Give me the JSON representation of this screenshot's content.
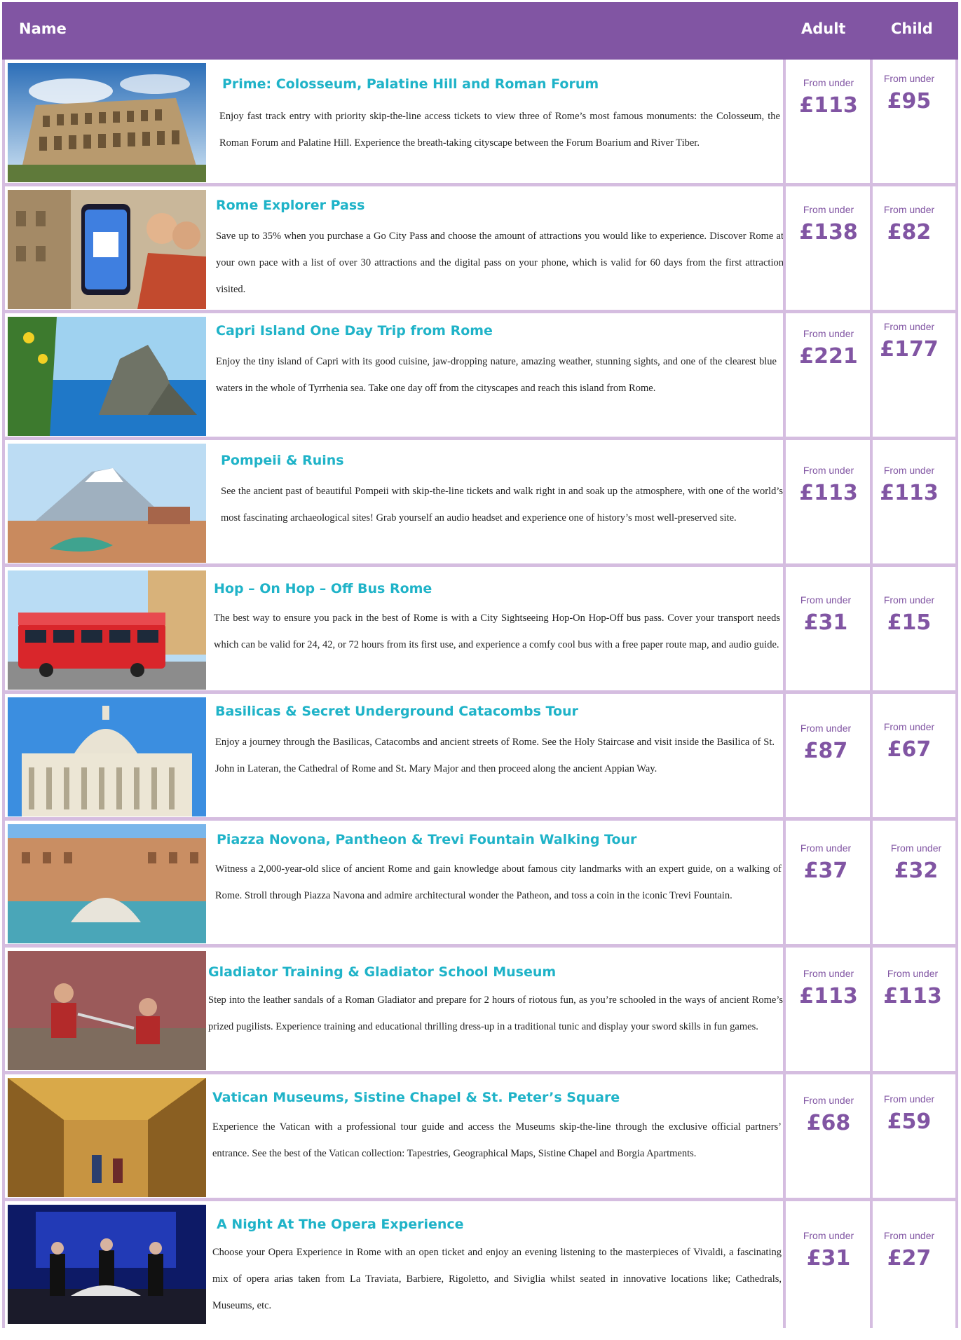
{
  "header": {
    "name": "Name",
    "adult": "Adult",
    "child": "Child"
  },
  "rows": [
    {
      "title": "Prime: Colosseum, Palatine Hill and Roman Forum",
      "desc": "Enjoy fast track entry with priority skip-the-line access tickets to view three of Rome’s most famous monuments: the Colosseum, the Roman Forum and Palatine Hill. Experience the breath-taking cityscape between the Forum Boarium and River Tiber.",
      "adult_from": "From under",
      "adult_price": "£113",
      "child_from": "From under",
      "child_price": "£95"
    },
    {
      "title": "Rome Explorer Pass",
      "desc": "Save up to 35% when you purchase a Go City Pass and choose the amount of attractions you would like to experience. Discover Rome at your own pace with a list of over 30 attractions and the digital pass on your phone, which is valid for 60 days from the first attraction visited.",
      "adult_from": "From under",
      "adult_price": "£138",
      "child_from": "From under",
      "child_price": "£82"
    },
    {
      "title": "Capri Island One Day Trip from Rome",
      "desc": "Enjoy the tiny island of Capri with its good cuisine, jaw-dropping nature, amazing weather, stunning sights, and one of the clearest blue waters in the whole of Tyrrhenia sea. Take one day off from the cityscapes and reach this island from Rome.",
      "adult_from": "From under",
      "adult_price": "£221",
      "child_from": "From under",
      "child_price": "£177"
    },
    {
      "title": "Pompeii & Ruins",
      "desc": "See the ancient past of beautiful Pompeii with skip-the-line tickets and walk right in and soak up the atmosphere, with one of the world’s most fascinating archaeological sites! Grab yourself an audio headset and experience one of history’s most well-preserved site.",
      "adult_from": "From under",
      "adult_price": "£113",
      "child_from": "From under",
      "child_price": "£113"
    },
    {
      "title": "Hop – On Hop – Off Bus Rome",
      "desc": "The best way to ensure you pack in the best of Rome is with a City Sightseeing Hop-On Hop-Off bus pass. Cover your transport needs which can be valid for 24, 42, or 72 hours from its first use, and experience a comfy cool bus with a free paper route map, and audio guide.",
      "adult_from": "From under",
      "adult_price": "£31",
      "child_from": "From under",
      "child_price": "£15"
    },
    {
      "title": "Basilicas & Secret Underground Catacombs Tour",
      "desc": "Enjoy a journey through the Basilicas, Catacombs and ancient streets of Rome. See the Holy Staircase and visit inside the Basilica of St. John in Lateran, the Cathedral of Rome and St. Mary Major and then proceed along the ancient Appian Way.",
      "adult_from": "From under",
      "adult_price": "£87",
      "child_from": "From under",
      "child_price": "£67"
    },
    {
      "title": "Piazza Novona, Pantheon & Trevi Fountain Walking Tour",
      "desc": "Witness a 2,000-year-old slice of ancient Rome and gain knowledge about famous city landmarks with an expert guide, on a walking of Rome. Stroll through Piazza Navona and admire architectural wonder the Patheon, and toss a coin in the iconic Trevi Fountain.",
      "adult_from": "From under",
      "adult_price": "£37",
      "child_from": "From under",
      "child_price": "£32"
    },
    {
      "title": "Gladiator Training & Gladiator School Museum",
      "desc": "Step into the leather sandals of a Roman Gladiator and prepare for 2 hours of riotous fun, as you’re schooled in the ways of ancient Rome’s prized pugilists. Experience training and educational thrilling dress-up in a traditional tunic and display your sword skills in fun games.",
      "adult_from": "From under",
      "adult_price": "£113",
      "child_from": "From under",
      "child_price": "£113"
    },
    {
      "title": "Vatican Museums, Sistine Chapel & St. Peter’s Square",
      "desc": "Experience the Vatican with a professional tour guide and access the Museums skip-the-line through the exclusive official partners’ entrance. See the best of the Vatican collection: Tapestries, Geographical Maps, Sistine Chapel and Borgia Apartments.",
      "adult_from": "From under",
      "adult_price": "£68",
      "child_from": "From under",
      "child_price": "£59"
    },
    {
      "title": "A Night At The Opera Experience",
      "desc": "Choose your Opera Experience in Rome with an open ticket and enjoy an evening listening to the masterpieces of Vivaldi, a fascinating mix of opera arias taken from La Traviata, Barbiere, Rigoletto, and Siviglia whilst seated in innovative locations like; Cathedrals, Museums, etc.",
      "adult_from": "From under",
      "adult_price": "£31",
      "child_from": "From under",
      "child_price": "£27"
    }
  ]
}
